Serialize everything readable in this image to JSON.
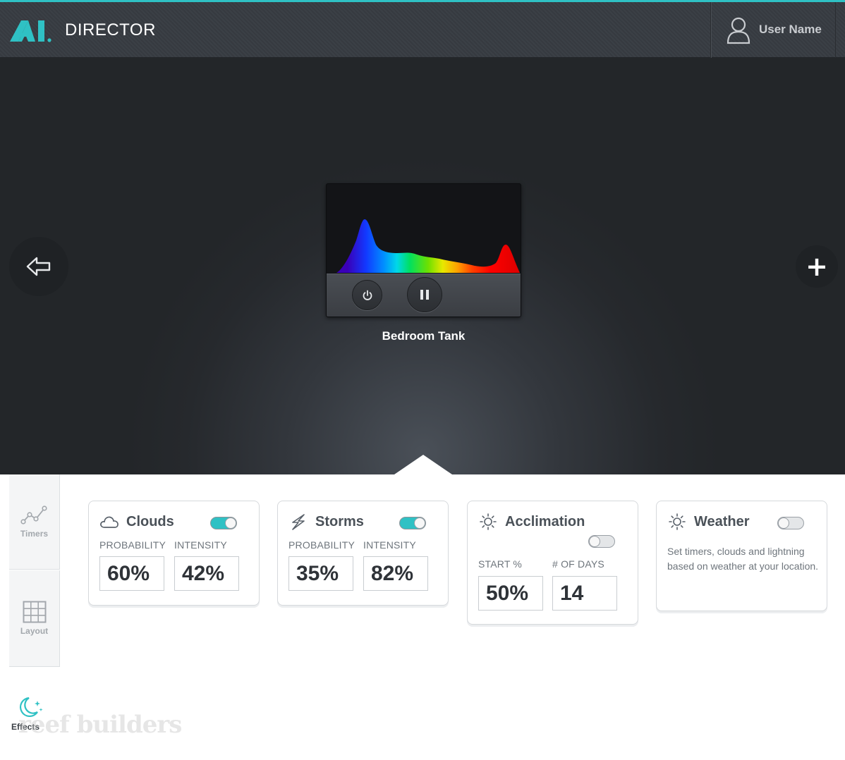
{
  "header": {
    "app_title": "DIRECTOR",
    "logo_icon": "ai-logo",
    "user_name": "User Name",
    "accent_color": "#2fc1c4"
  },
  "stage": {
    "prev_icon": "arrow-left-icon",
    "add_label": "+",
    "device": {
      "name": "Bedroom Tank",
      "power_icon": "power-icon",
      "pause_icon": "pause-icon"
    }
  },
  "side_tabs": [
    {
      "label": "Timers",
      "icon": "chart-line-icon"
    },
    {
      "label": "Layout",
      "icon": "grid-icon"
    },
    {
      "label": "Effects",
      "icon": "moon-stars-icon"
    }
  ],
  "watermark": "reef builders",
  "effects": {
    "clouds": {
      "title": "Clouds",
      "enabled": true,
      "label_1": "PROBABILITY",
      "label_2": "INTENSITY",
      "value_1": "60%",
      "value_2": "42%"
    },
    "storms": {
      "title": "Storms",
      "enabled": true,
      "label_1": "PROBABILITY",
      "label_2": "INTENSITY",
      "value_1": "35%",
      "value_2": "82%"
    },
    "acclimation": {
      "title": "Acclimation",
      "enabled": false,
      "label_1": "START %",
      "label_2": "# OF DAYS",
      "value_1": "50%",
      "value_2": "14"
    },
    "weather": {
      "title": "Weather",
      "enabled": false,
      "description": "Set timers, clouds and lightning based on weather at your location."
    }
  }
}
